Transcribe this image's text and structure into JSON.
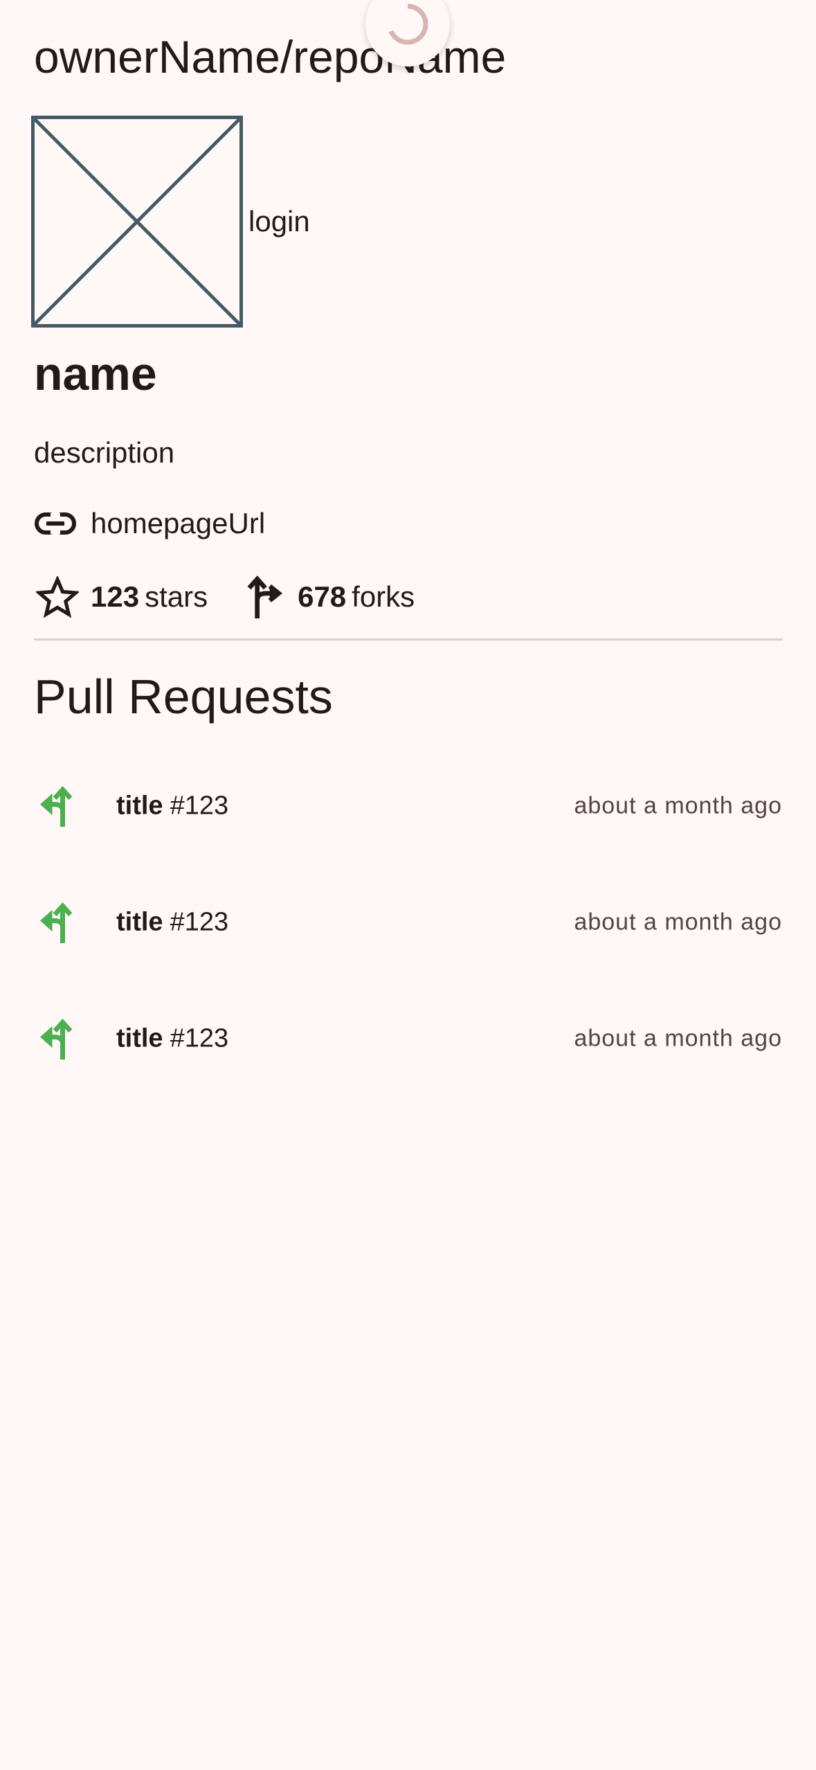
{
  "header": {
    "title": "ownerName/repoName"
  },
  "owner": {
    "avatar_icon": "broken-image-placeholder",
    "login": "login"
  },
  "repo": {
    "name": "name",
    "description": "description",
    "homepage": {
      "icon": "link-icon",
      "url": "homepageUrl"
    },
    "stats": {
      "stars": {
        "icon": "star-outline-icon",
        "count": "123",
        "label": "stars"
      },
      "forks": {
        "icon": "fork-icon",
        "count": "678",
        "label": "forks"
      }
    }
  },
  "pull_requests": {
    "section_title": "Pull Requests",
    "items": [
      {
        "icon": "merge-icon",
        "title": "title",
        "number": "#123",
        "time": "about a month ago"
      },
      {
        "icon": "merge-icon",
        "title": "title",
        "number": "#123",
        "time": "about a month ago"
      },
      {
        "icon": "merge-icon",
        "title": "title",
        "number": "#123",
        "time": "about a month ago"
      }
    ]
  },
  "colors": {
    "background": "#fff8f6",
    "text": "#231918",
    "pr_icon": "#4caf50",
    "avatar_border": "#455a64",
    "spinner": "#d8b5b1"
  }
}
